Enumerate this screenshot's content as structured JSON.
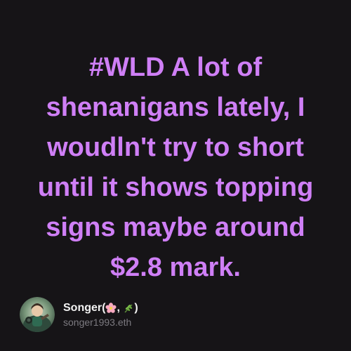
{
  "post": {
    "text": "#WLD A lot of\nshenanigans lately, I\nwoudln't try to short\nuntil it shows topping\nsigns maybe around\n$2.8 mark."
  },
  "author": {
    "name_prefix": "Songer(",
    "name_separator": ", ",
    "name_suffix": ")",
    "handle": "songer1993.eth",
    "emoji_1": "cherry-blossom-icon",
    "emoji_2": "herb-icon",
    "avatar": "user-avatar-icon"
  },
  "colors": {
    "background": "#161417",
    "post_text": "#cf7ff6",
    "author_name": "#f2f2f2",
    "author_handle": "#7c7a80"
  }
}
